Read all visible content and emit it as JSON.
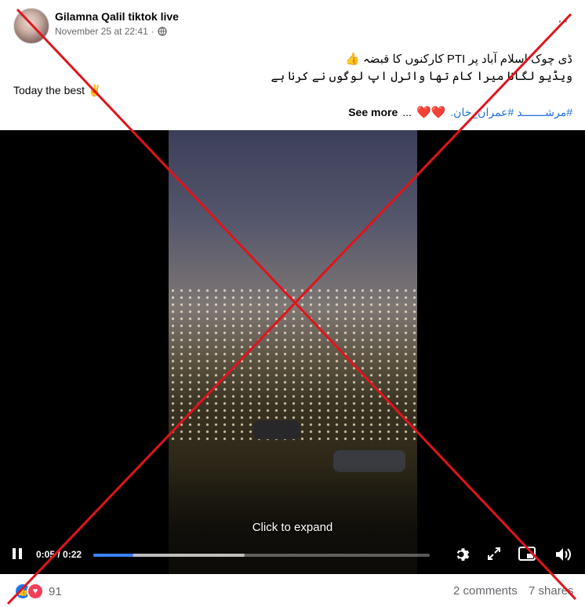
{
  "post": {
    "author": "Gilamna Qalil tiktok live",
    "timestamp": "November 25 at 22:41",
    "more_icon": "more-dots-icon",
    "privacy_icon": "globe-icon"
  },
  "content": {
    "urdu_line_1": "ڈی چوک اسلام آباد پر PTI کارکنوں کا قبضہ 👍",
    "urdu_line_2": "ویڈیو لگانا میرا کام تھا وائرل اپ لوگوں نے کرنا ہے",
    "today_line": "Today the best ✌️",
    "see_more_label": "See more",
    "ellipsis": "...",
    "hearts": "❤️❤️",
    "hashtags": "#مرشـــــــد #عمران_خان."
  },
  "video": {
    "overlay_text": "Click to expand",
    "current_time": "0:05",
    "duration": "0:22",
    "time_display": "0:05 / 0:22",
    "played_fraction": 0.12,
    "buffered_fraction": 0.45,
    "accent_color": "#3b82f6"
  },
  "footer": {
    "reaction_count": "91",
    "comments_label": "2 comments",
    "shares_label": "7 shares"
  },
  "overlay": {
    "cross_color": "#e0141b"
  }
}
